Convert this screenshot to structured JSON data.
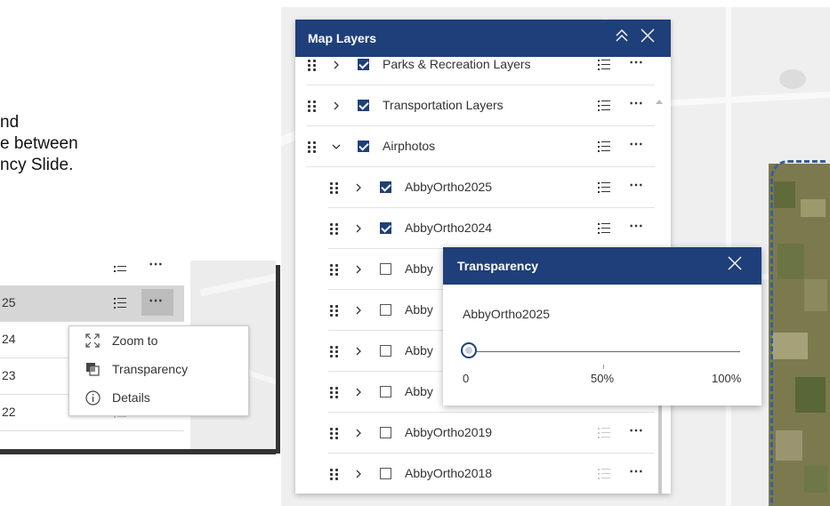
{
  "instructions": {
    "lines": [
      "nd",
      "e between",
      "ncy Slide."
    ]
  },
  "inset": {
    "rows": [
      {
        "label": "",
        "more": "⋯"
      },
      {
        "label": "25",
        "more": "⋯"
      },
      {
        "label": "24"
      },
      {
        "label": "23"
      },
      {
        "label": "22",
        "more": "⋯"
      }
    ],
    "context_menu": {
      "items": [
        {
          "label": "Zoom to",
          "icon": "zoom-to-icon"
        },
        {
          "label": "Transparency",
          "icon": "transparency-icon"
        },
        {
          "label": "Details",
          "icon": "info-icon"
        }
      ]
    }
  },
  "panel": {
    "title": "Map Layers",
    "collapse_icon": "double-chevron-up-icon",
    "close_icon": "close-icon",
    "layers": [
      {
        "label": "Parks & Recreation Layers",
        "checked": true,
        "expanded": false,
        "indent": 0
      },
      {
        "label": "Transportation Layers",
        "checked": true,
        "expanded": false,
        "indent": 0
      },
      {
        "label": "Airphotos",
        "checked": true,
        "expanded": true,
        "indent": 0
      },
      {
        "label": "AbbyOrtho2025",
        "checked": true,
        "expanded": false,
        "indent": 1
      },
      {
        "label": "AbbyOrtho2024",
        "checked": true,
        "expanded": false,
        "indent": 1
      },
      {
        "label": "Abby",
        "checked": false,
        "expanded": false,
        "indent": 1
      },
      {
        "label": "Abby",
        "checked": false,
        "expanded": false,
        "indent": 1
      },
      {
        "label": "Abby",
        "checked": false,
        "expanded": false,
        "indent": 1
      },
      {
        "label": "Abby",
        "checked": false,
        "expanded": false,
        "indent": 1
      },
      {
        "label": "AbbyOrtho2019",
        "checked": false,
        "expanded": false,
        "indent": 1
      },
      {
        "label": "AbbyOrtho2018",
        "checked": false,
        "expanded": false,
        "indent": 1
      }
    ]
  },
  "transparency": {
    "title": "Transparency",
    "layer": "AbbyOrtho2025",
    "value_percent": 0,
    "ticks": {
      "min": "0",
      "mid": "50%",
      "max": "100%"
    }
  },
  "colors": {
    "header": "#1f3f7a",
    "accent": "#1f3f7a",
    "boundary": "#3a5c9a"
  }
}
